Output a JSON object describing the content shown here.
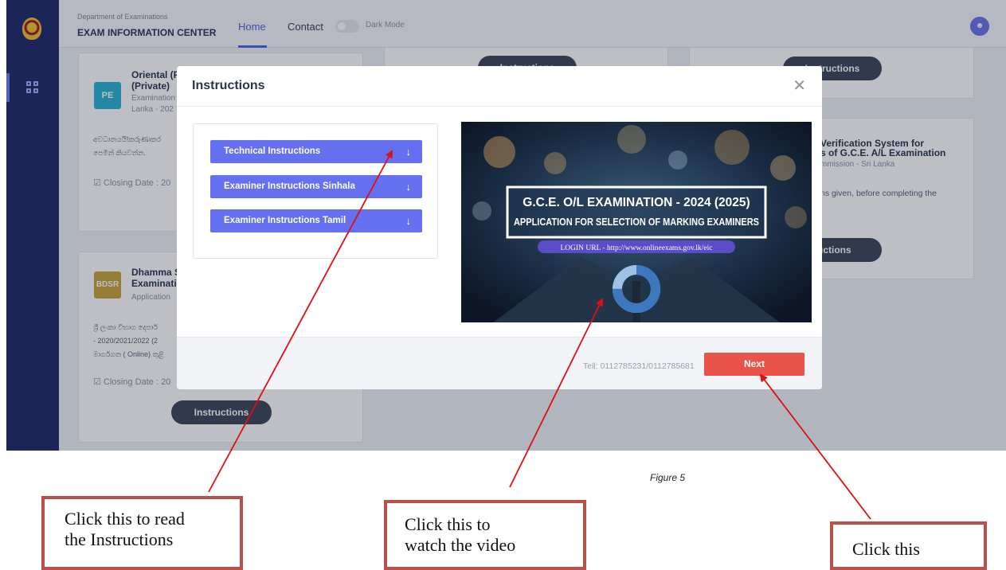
{
  "app": {
    "department": "Department of Examinations",
    "center": "EXAM INFORMATION CENTER",
    "nav": {
      "home": "Home",
      "contact": "Contact",
      "dark_mode": "Dark Mode"
    }
  },
  "background_cards": {
    "card1": {
      "badge": "PE",
      "title_line1": "Oriental (P",
      "title_line2": "(Private)",
      "sub_line1": "Examination",
      "sub_line2": "Lanka - 202",
      "body_line1": "අවධානයයි!කරුණාකර",
      "body_line2": "පෙමින් කියවන්න.",
      "closing": "Closing Date : 20",
      "badge_color": "#2db3cf"
    },
    "card2": {
      "badge": "BDSR",
      "title_line1": "Dhamma S",
      "title_line2": "Examinati",
      "sub_line1": "Application",
      "body_line1": "ශ්‍රී ලංකා විභාග දෙපාර්",
      "body_line2": "- 2020/2021/2022 (2",
      "body_line3": "මාර්ගගත ( Online) තුළි",
      "closing": "Closing Date : 20",
      "button": "Instructions",
      "badge_color": "#c9a43a"
    },
    "card_mid_button": "Instructions",
    "card_right_top_button": "Instructions",
    "card_right": {
      "title_line1": "Verification System for",
      "title_line2": "s of G.C.E. A/L Examination",
      "sub": "mmission - Sri Lanka",
      "body": "ns given, before completing the",
      "button": "ructions"
    }
  },
  "modal": {
    "title": "Instructions",
    "accordion": [
      {
        "label": "Technical Instructions",
        "icon": "arrow-down-icon"
      },
      {
        "label": "Examiner Instructions Sinhala",
        "icon": "arrow-down-icon"
      },
      {
        "label": "Examiner Instructions Tamil",
        "icon": "arrow-down-icon"
      }
    ],
    "video": {
      "headline1": "G.C.E. O/L EXAMINATION - 2024 (2025)",
      "headline2": "APPLICATION FOR SELECTION OF MARKING EXAMINERS",
      "login_url": "LOGIN URL - http://www.onlineexams.gov.lk/eic",
      "loading": 0.25
    },
    "tel": "Tell: 0112785231/0112785681",
    "next": "Next"
  },
  "annotations": {
    "figure": "Figure 5",
    "callout1_line1": "Click this to read",
    "callout1_line2": "the Instructions",
    "callout2_line1": "Click this to",
    "callout2_line2": "watch the video",
    "callout3": "Click this",
    "arrow_color": "#e01010"
  }
}
